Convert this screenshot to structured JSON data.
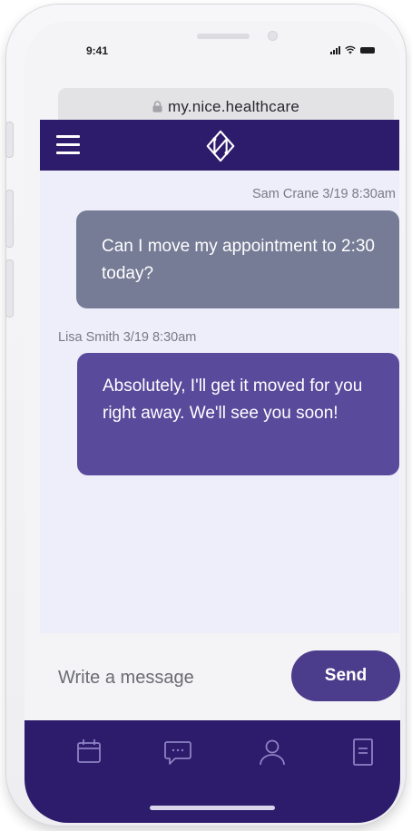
{
  "status_bar": {
    "time": "9:41"
  },
  "browser": {
    "url": "my.nice.healthcare"
  },
  "chat": {
    "messages": [
      {
        "sender_meta": "Sam Crane 3/19 8:30am",
        "text": "Can I move my appointment to 2:30 today?",
        "direction": "incoming"
      },
      {
        "sender_meta": "Lisa Smith 3/19 8:30am",
        "text": "Absolutely, I'll get it moved for you right away. We'll see you soon!",
        "direction": "outgoing"
      }
    ]
  },
  "composer": {
    "placeholder": "Write a message",
    "send_label": "Send"
  },
  "nav": {
    "tabs": [
      {
        "icon": "calendar-icon"
      },
      {
        "icon": "chat-bubble-icon"
      },
      {
        "icon": "user-icon"
      },
      {
        "icon": "document-icon"
      }
    ]
  },
  "colors": {
    "brand_dark": "#2d1b6b",
    "incoming_bubble": "#767b96",
    "outgoing_bubble": "#5a4a9c",
    "send_button": "#4b3c8c",
    "chat_background": "#eeeefb"
  }
}
